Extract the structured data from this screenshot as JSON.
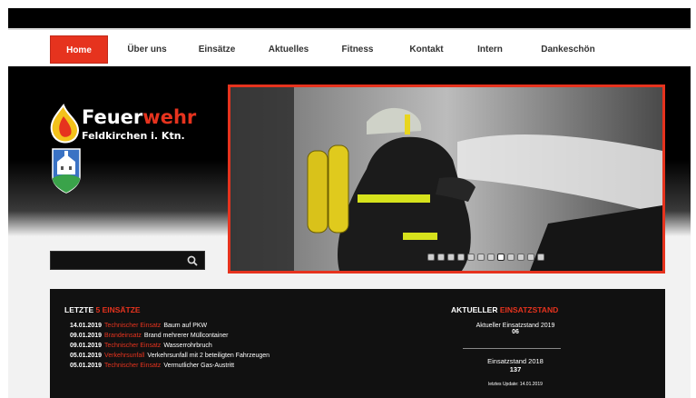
{
  "nav": {
    "items": [
      {
        "label": "Home",
        "active": true
      },
      {
        "label": "Über uns",
        "active": false
      },
      {
        "label": "Einsätze",
        "active": false
      },
      {
        "label": "Aktuelles",
        "active": false
      },
      {
        "label": "Fitness",
        "active": false
      },
      {
        "label": "Kontakt",
        "active": false
      },
      {
        "label": "Intern",
        "active": false
      },
      {
        "label": "Dankeschön",
        "active": false
      }
    ]
  },
  "logo": {
    "title_a": "Feuer",
    "title_b": "wehr",
    "subtitle": "Feldkirchen i. Ktn."
  },
  "slider": {
    "dot_count": 12,
    "active_dot": 7
  },
  "search": {
    "icon": "search-icon"
  },
  "latest": {
    "heading_a": "LETZTE ",
    "heading_b": "5 EINSÄTZE",
    "rows": [
      {
        "date": "14.01.2019",
        "type": "Technischer Einsatz",
        "text": "Baum auf PKW"
      },
      {
        "date": "09.01.2019",
        "type": "Brandeinsatz",
        "text": "Brand mehrerer Müllcontainer"
      },
      {
        "date": "09.01.2019",
        "type": "Technischer Einsatz",
        "text": "Wasserrohrbruch"
      },
      {
        "date": "05.01.2019",
        "type": "Verkehrsunfall",
        "text": "Verkehrsunfall mit 2 beteiligten Fahrzeugen"
      },
      {
        "date": "05.01.2019",
        "type": "Technischer Einsatz",
        "text": "Vermutlicher Gas-Austritt"
      }
    ]
  },
  "stand": {
    "heading_a": "AKTUELLER ",
    "heading_b": "EINSATZSTAND",
    "current_label": "Aktueller Einsatzstand 2019",
    "current_value": "06",
    "prev_label": "Einsatzstand 2018",
    "prev_value": "137",
    "update": "letztes Update: 14.01.2019"
  },
  "colors": {
    "accent": "#e6331e",
    "dark": "#111111"
  }
}
